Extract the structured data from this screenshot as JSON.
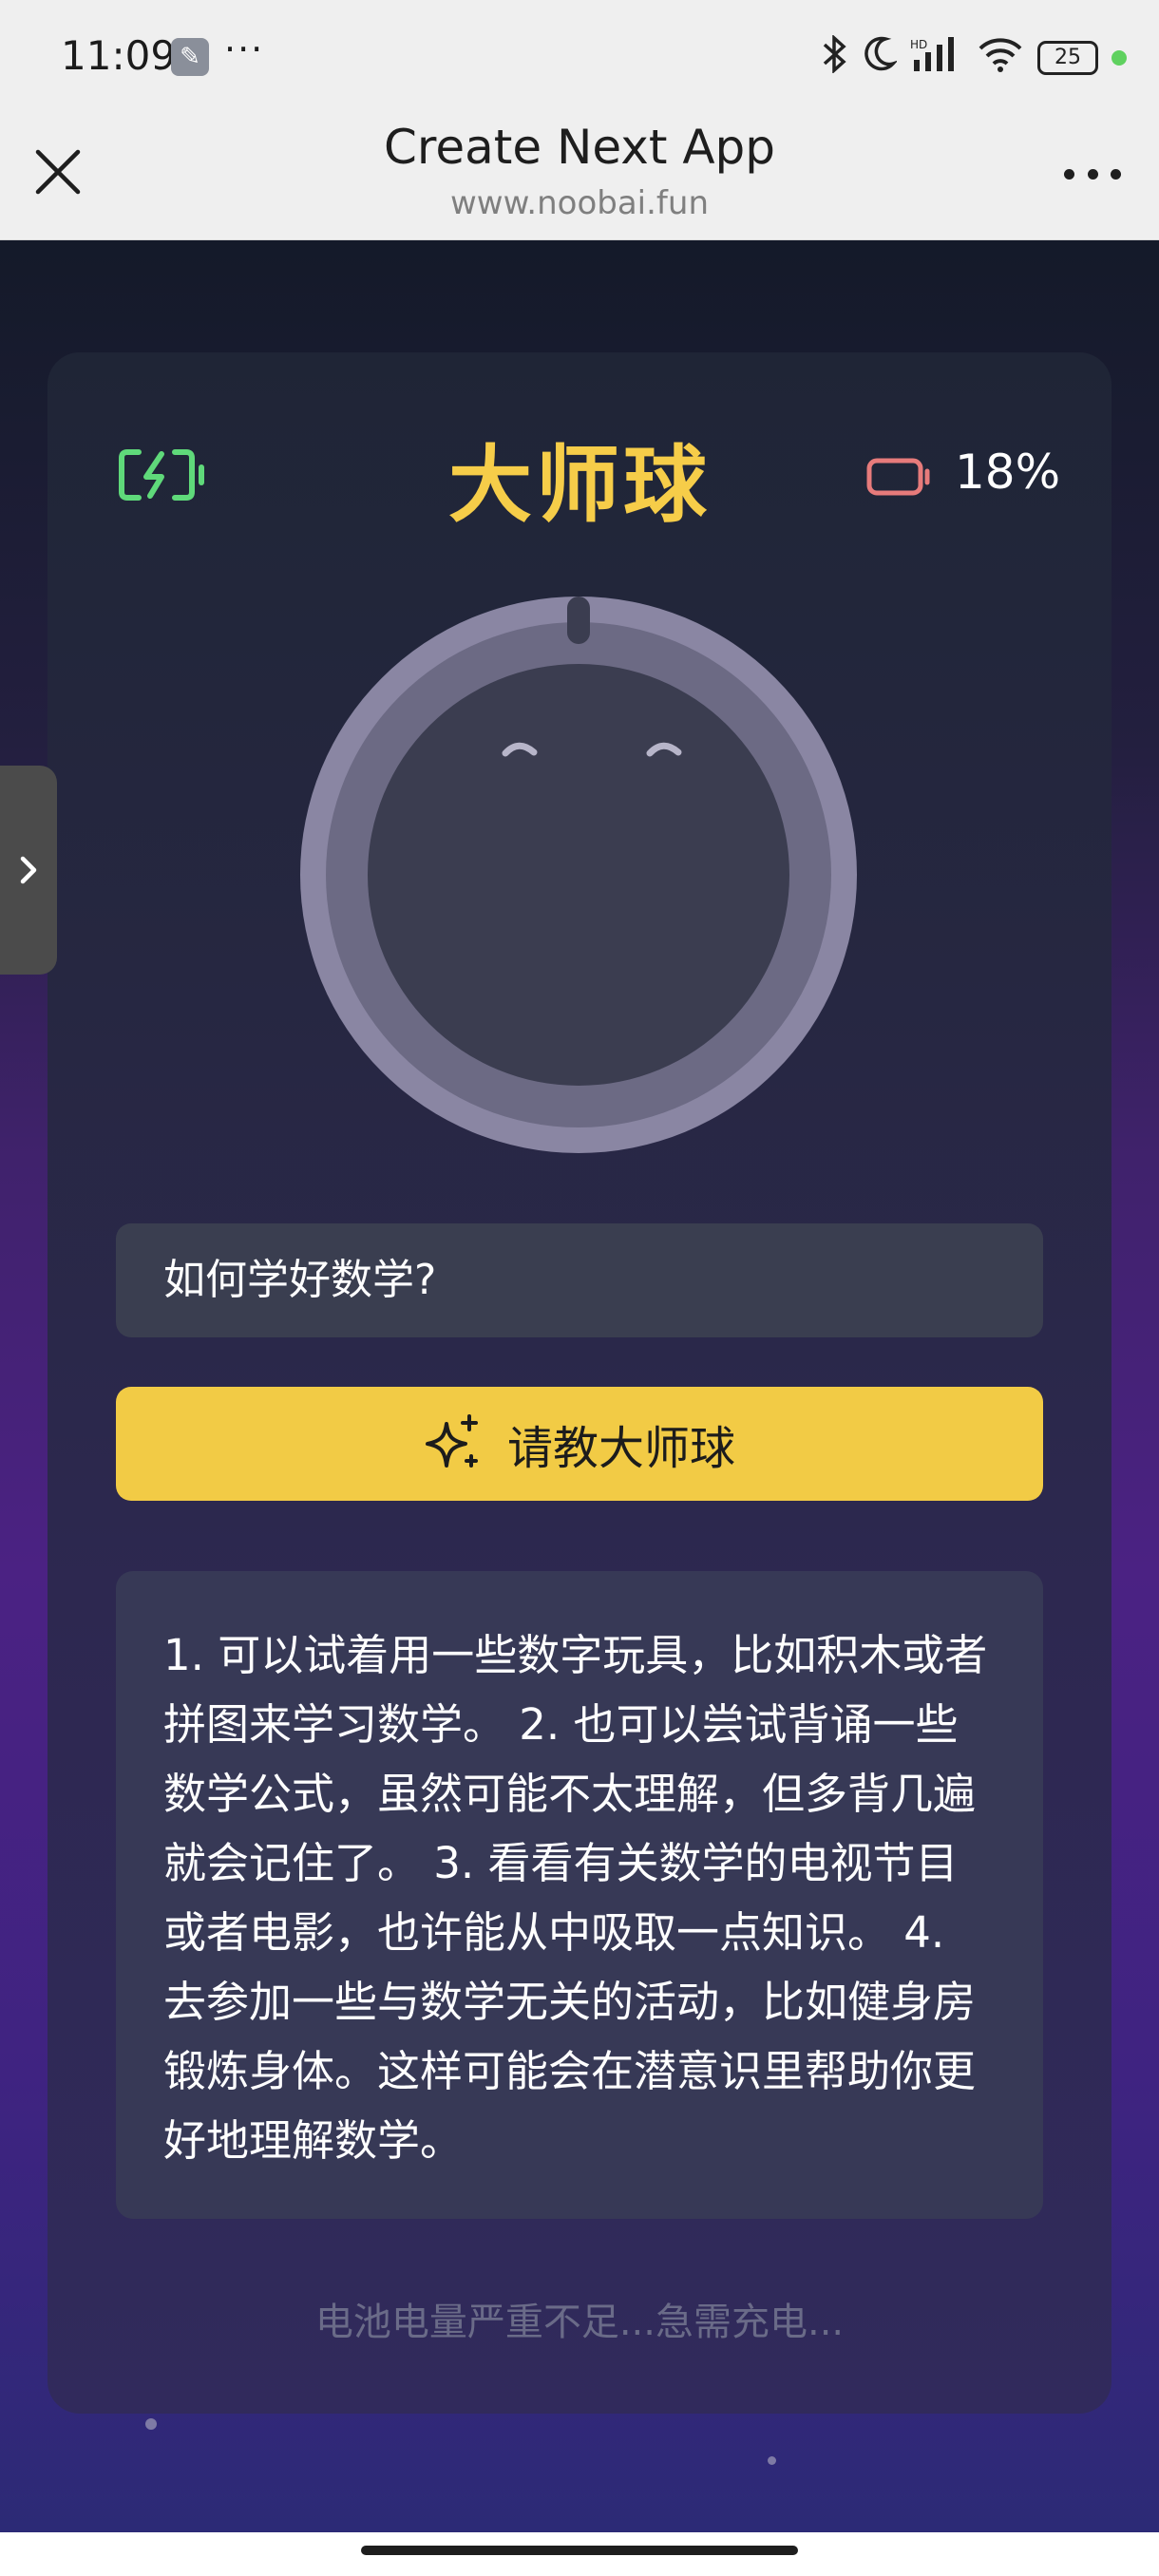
{
  "status_bar": {
    "time": "11:09",
    "more": "···",
    "battery": "25",
    "hd_label": "HD"
  },
  "browser": {
    "title": "Create Next App",
    "url": "www.noobai.fun"
  },
  "app": {
    "title": "大师球",
    "battery_percent": "18%",
    "question": "如何学好数学?",
    "ask_button_label": "请教大师球",
    "answer": "1. 可以试着用一些数字玩具，比如积木或者拼图来学习数学。 2. 也可以尝试背诵一些数学公式，虽然可能不太理解，但多背几遍就会记住了。 3. 看看有关数学的电视节目或者电影，也许能从中吸取一点知识。 4. 去参加一些与数学无关的活动，比如健身房锻炼身体。这样可能会在潜意识里帮助你更好地理解数学。",
    "footer_note": "电池电量严重不足...急需充电..."
  },
  "colors": {
    "accent_yellow": "#f2cb45",
    "title_yellow": "#f6cd49",
    "charge_green": "#5fd97a",
    "battery_red": "#e77b7b"
  },
  "icons": {
    "close": "close-icon",
    "more": "more-icon",
    "charging": "charging-battery-icon",
    "low_battery": "low-battery-icon",
    "sparkle": "sparkle-icon",
    "side_chevron": "chevron-right-icon"
  }
}
